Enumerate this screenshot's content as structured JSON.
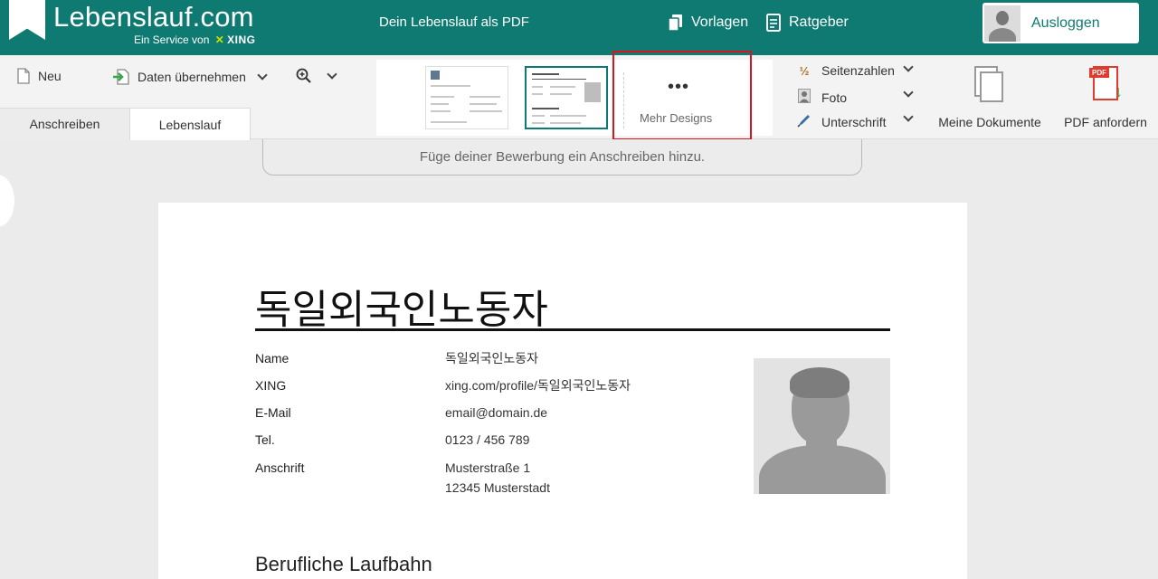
{
  "header": {
    "logo": "Lebenslauf.com",
    "service_prefix": "Ein Service von",
    "service_brand_x": "✕",
    "service_brand": "XING",
    "tagline": "Dein Lebenslauf als PDF",
    "nav": [
      {
        "label": "Vorlagen",
        "icon": "copy-icon"
      },
      {
        "label": "Ratgeber",
        "icon": "document-icon"
      }
    ],
    "logout_label": "Ausloggen"
  },
  "toolbar": {
    "new_label": "Neu",
    "import_label": "Daten übernehmen",
    "tabs": [
      "Anschreiben",
      "Lebenslauf"
    ],
    "active_tab": "Lebenslauf",
    "more_designs_dots": "•••",
    "more_designs_label": "Mehr Designs",
    "options": [
      {
        "label": "Seitenzahlen",
        "icon": "½"
      },
      {
        "label": "Foto",
        "icon": "portrait-icon"
      },
      {
        "label": "Unterschrift",
        "icon": "pen-icon"
      }
    ],
    "my_documents_label": "Meine Dokumente",
    "request_pdf_label": "PDF anfordern",
    "pdf_tag": "PDF"
  },
  "cover_letter_hint": "Füge deiner Bewerbung ein Anschreiben hinzu.",
  "cv": {
    "title": "독일외국인노동자",
    "fields": [
      {
        "key": "Name",
        "value": "독일외국인노동자"
      },
      {
        "key": "XING",
        "value": "xing.com/profile/독일외국인노동자"
      },
      {
        "key": "E-Mail",
        "value": "email@domain.de"
      },
      {
        "key": "Tel.",
        "value": "0123 / 456 789"
      },
      {
        "key": "Anschrift",
        "value": "Musterstraße 1\n12345 Musterstadt"
      }
    ],
    "section_title": "Berufliche Laufbahn"
  },
  "colors": {
    "header_bg": "#0e7a71",
    "highlight": "#d9141c",
    "xing_accent": "#c8e000"
  }
}
